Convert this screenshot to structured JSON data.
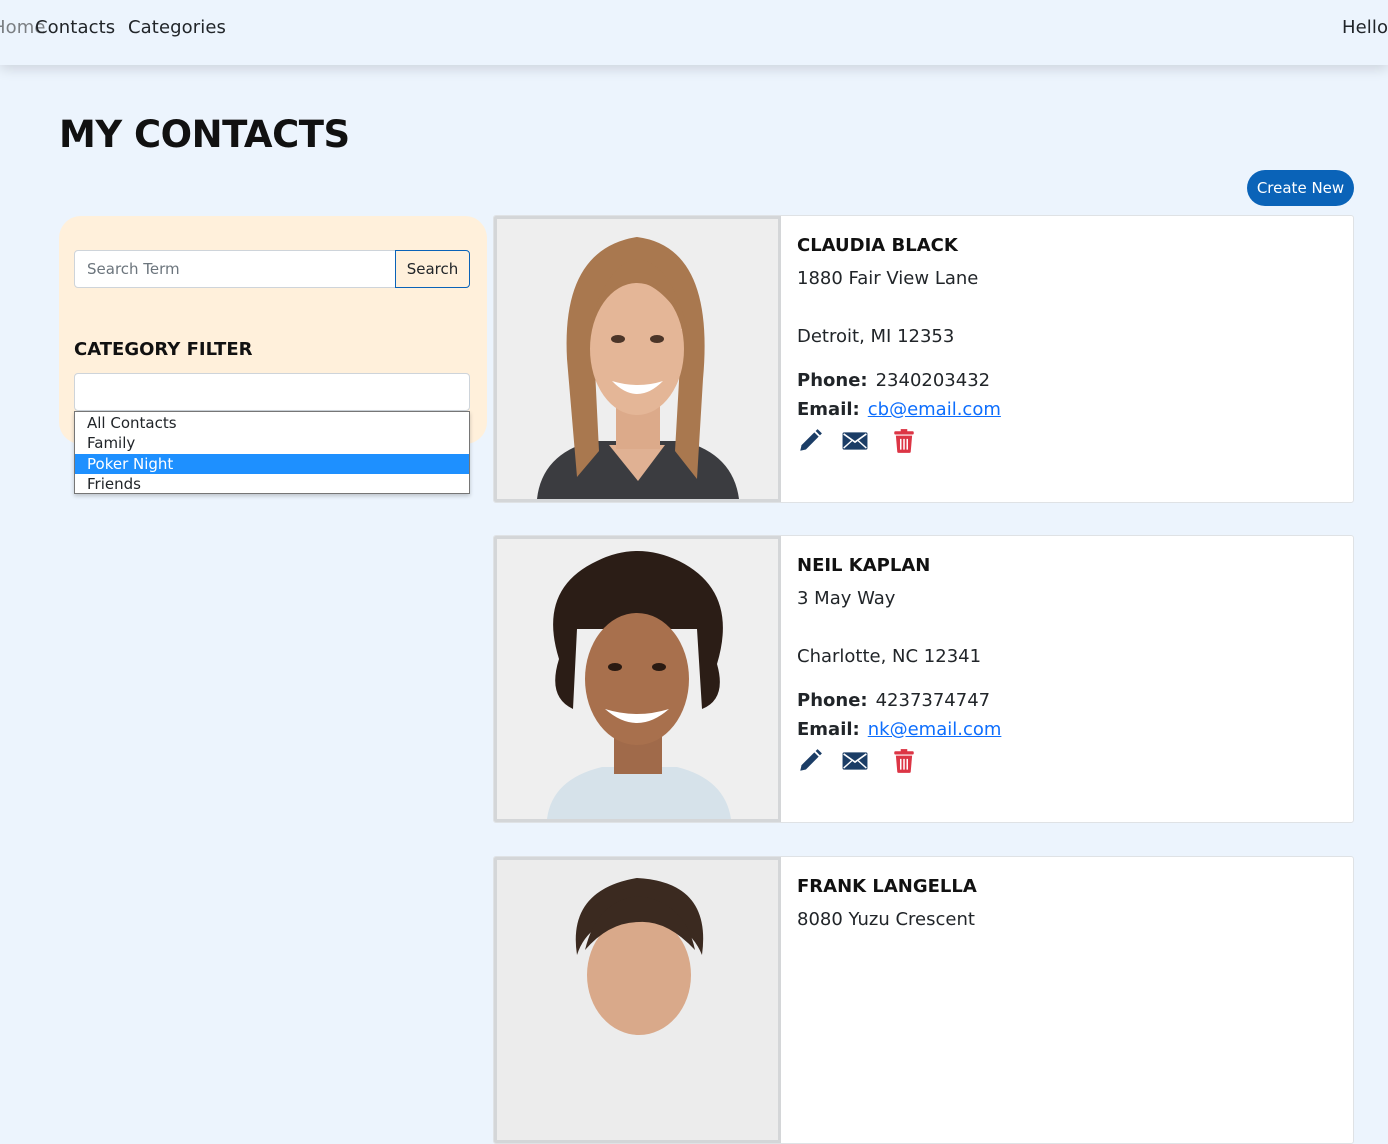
{
  "nav": {
    "home": "Home",
    "contacts": "Contacts",
    "categories": "Categories",
    "greeting": "Hello"
  },
  "page": {
    "title": "MY CONTACTS",
    "create_button": "Create New"
  },
  "sidebar": {
    "search_placeholder": "Search Term",
    "search_button": "Search",
    "filter_title": "CATEGORY FILTER",
    "options": [
      "All Contacts",
      "Family",
      "Poker Night",
      "Friends"
    ],
    "selected_option": "Poker Night"
  },
  "contacts": [
    {
      "name": "CLAUDIA BLACK",
      "street": "1880 Fair View Lane",
      "city": "Detroit, MI 12353",
      "phone_label": "Phone:",
      "phone": "2340203432",
      "email_label": "Email:",
      "email": "cb@email.com"
    },
    {
      "name": "NEIL KAPLAN",
      "street": "3 May Way",
      "city": "Charlotte, NC 12341",
      "phone_label": "Phone:",
      "phone": "4237374747",
      "email_label": "Email:",
      "email": "nk@email.com"
    },
    {
      "name": "FRANK LANGELLA",
      "street": "8080 Yuzu Crescent"
    }
  ],
  "icons": {
    "edit": "pencil-icon",
    "email": "envelope-icon",
    "delete": "trash-icon"
  },
  "colors": {
    "page_bg": "#ecf4fd",
    "sidebar_bg": "#fff0db",
    "primary": "#0a63b8",
    "icon_blue": "#1b3d66",
    "icon_red": "#dc3545",
    "selected_option_bg": "#1e90ff",
    "link": "#0d6efd"
  }
}
